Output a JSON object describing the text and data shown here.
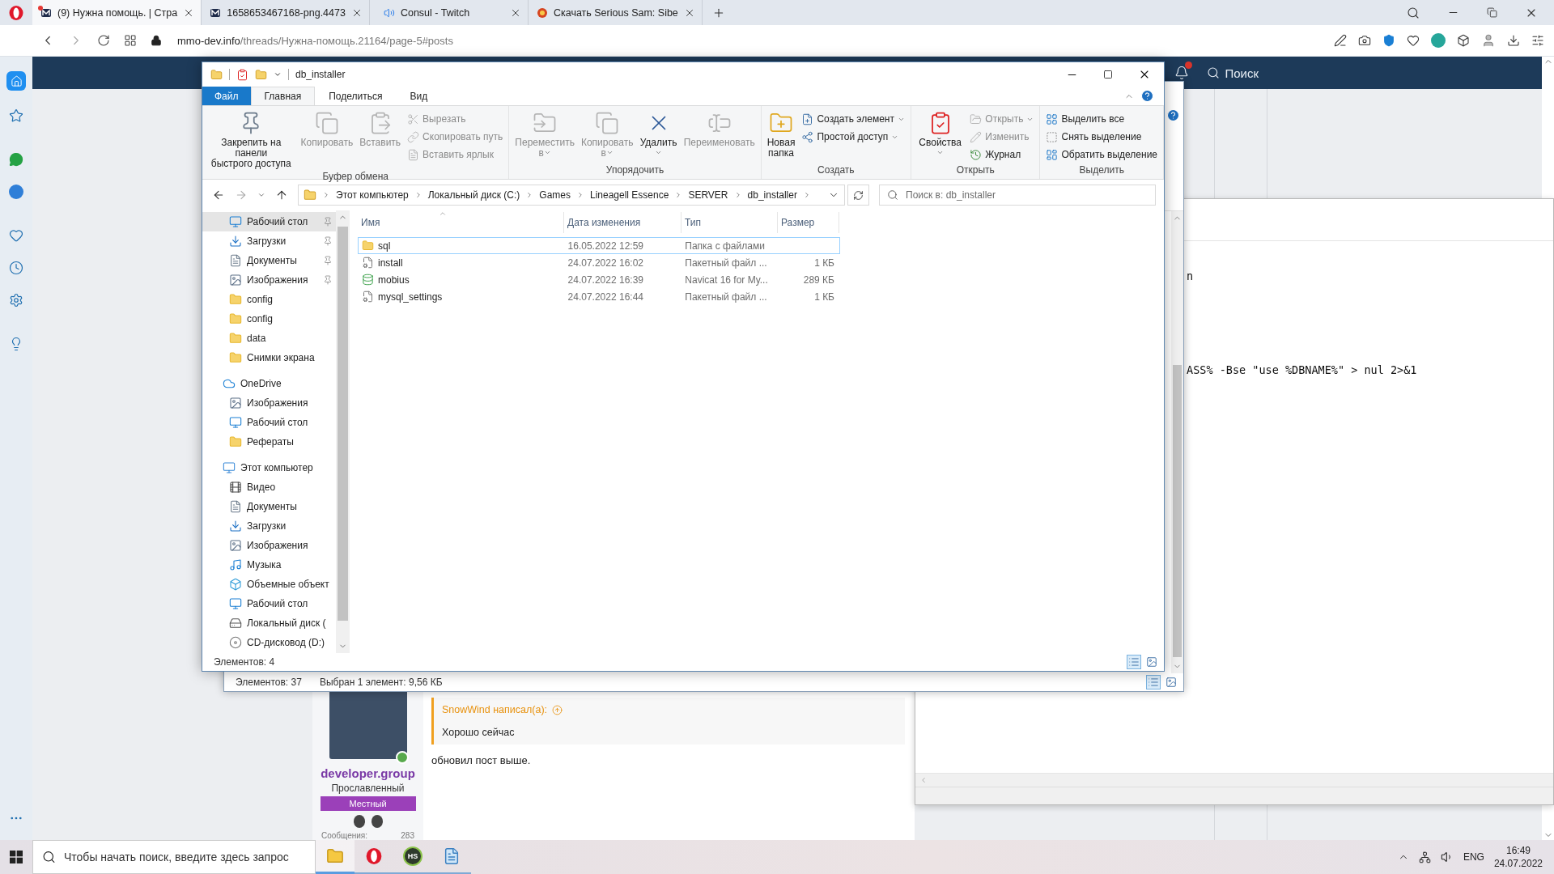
{
  "browser": {
    "tabs": [
      {
        "title": "(9) Нужна помощь. | Стра",
        "kind": "site",
        "unread": true,
        "audio": false,
        "selected": true
      },
      {
        "title": "1658653467168-png.4473",
        "kind": "site",
        "unread": false,
        "audio": false,
        "selected": false
      },
      {
        "title": "Consul - Twitch",
        "kind": "stream",
        "unread": false,
        "audio": true,
        "selected": false
      },
      {
        "title": "Скачать Serious Sam: Sibe",
        "kind": "game",
        "unread": false,
        "audio": false,
        "selected": false
      }
    ],
    "url": {
      "domain": "mmo-dev.info",
      "path": "/threads/Нужна-помощь.21164/page-5#posts"
    }
  },
  "web": {
    "search": "Поиск",
    "post": {
      "author": "developer.group",
      "user_title": "Прославленный",
      "banner": "Местный",
      "stats": [
        {
          "label": "Сообщения:",
          "value": "283"
        }
      ],
      "quote": {
        "author": "SnowWind написал(а):",
        "text": "Хорошо сейчас"
      },
      "message": "обновил пост выше."
    }
  },
  "editor": {
    "lines": [
      "n",
      "ASS% -Bse \"use %DBNAME%\" > nul 2>&1"
    ]
  },
  "old_explorer": {
    "status": [
      "Элементов: 37",
      "Выбран 1 элемент: 9,56 КБ"
    ]
  },
  "explorer": {
    "title": "db_installer",
    "ribbon_tabs": [
      {
        "label": "Файл",
        "kind": "file",
        "selected": false
      },
      {
        "label": "Главная",
        "kind": "tab",
        "selected": true
      },
      {
        "label": "Поделиться",
        "kind": "tab",
        "selected": false
      },
      {
        "label": "Вид",
        "kind": "tab",
        "selected": false
      }
    ],
    "ribbon_groups": [
      {
        "label": "Буфер обмена",
        "items": [
          {
            "kind": "large",
            "label": "Закрепить на панели\nбыстрого доступа",
            "disabled": false,
            "dropdown": false
          },
          {
            "kind": "large",
            "label": "Копировать",
            "disabled": true,
            "dropdown": false
          },
          {
            "kind": "large",
            "label": "Вставить",
            "disabled": true,
            "dropdown": false
          },
          {
            "kind": "stack",
            "items": [
              {
                "label": "Вырезать",
                "disabled": true,
                "dropdown": false
              },
              {
                "label": "Скопировать путь",
                "disabled": true,
                "dropdown": false
              },
              {
                "label": "Вставить ярлык",
                "disabled": true,
                "dropdown": false
              }
            ]
          }
        ]
      },
      {
        "label": "Упорядочить",
        "items": [
          {
            "kind": "large",
            "label": "Переместить\nв",
            "disabled": true,
            "dropdown": true
          },
          {
            "kind": "large",
            "label": "Копировать\nв",
            "disabled": true,
            "dropdown": true
          },
          {
            "kind": "large",
            "label": "Удалить",
            "disabled": false,
            "dropdown": true
          },
          {
            "kind": "large",
            "label": "Переименовать",
            "disabled": true,
            "dropdown": false
          }
        ]
      },
      {
        "label": "Создать",
        "items": [
          {
            "kind": "large",
            "label": "Новая\nпапка",
            "disabled": false,
            "dropdown": false
          },
          {
            "kind": "stack",
            "items": [
              {
                "label": "Создать элемент",
                "disabled": false,
                "dropdown": true
              },
              {
                "label": "Простой доступ",
                "disabled": false,
                "dropdown": true
              }
            ]
          }
        ]
      },
      {
        "label": "Открыть",
        "items": [
          {
            "kind": "large",
            "label": "Свойства",
            "disabled": false,
            "dropdown": true
          },
          {
            "kind": "stack",
            "items": [
              {
                "label": "Открыть",
                "disabled": true,
                "dropdown": true
              },
              {
                "label": "Изменить",
                "disabled": true,
                "dropdown": false
              },
              {
                "label": "Журнал",
                "disabled": false,
                "dropdown": false
              }
            ]
          }
        ]
      },
      {
        "label": "Выделить",
        "items": [
          {
            "kind": "stack",
            "items": [
              {
                "label": "Выделить все",
                "disabled": false,
                "dropdown": false
              },
              {
                "label": "Снять выделение",
                "disabled": false,
                "dropdown": false
              },
              {
                "label": "Обратить выделение",
                "disabled": false,
                "dropdown": false
              }
            ]
          }
        ]
      }
    ],
    "breadcrumbs": [
      "Этот компьютер",
      "Локальный диск (C:)",
      "Games",
      "Lineagell Essence",
      "SERVER",
      "db_installer"
    ],
    "search_placeholder": "Поиск в: db_installer",
    "nav_pane": {
      "quick_access": [
        {
          "label": "Рабочий стол",
          "kind": "desktop",
          "pinned": true,
          "selected": true
        },
        {
          "label": "Загрузки",
          "kind": "download",
          "pinned": true,
          "selected": false
        },
        {
          "label": "Документы",
          "kind": "documents",
          "pinned": true,
          "selected": false
        },
        {
          "label": "Изображения",
          "kind": "pictures",
          "pinned": true,
          "selected": false
        },
        {
          "label": "config",
          "kind": "folder",
          "pinned": false,
          "selected": false
        },
        {
          "label": "config",
          "kind": "folder",
          "pinned": false,
          "selected": false
        },
        {
          "label": "data",
          "kind": "folder",
          "pinned": false,
          "selected": false
        },
        {
          "label": "Снимки экрана",
          "kind": "folder",
          "pinned": false,
          "selected": false
        }
      ],
      "roots": [
        {
          "label": "OneDrive",
          "kind": "onedrive",
          "selected": false,
          "children": [
            {
              "label": "Изображения",
              "kind": "pictures",
              "selected": false
            },
            {
              "label": "Рабочий стол",
              "kind": "desktop",
              "selected": false
            },
            {
              "label": "Рефераты",
              "kind": "folder",
              "selected": false
            }
          ]
        },
        {
          "label": "Этот компьютер",
          "kind": "computer",
          "selected": false,
          "children": [
            {
              "label": "Видео",
              "kind": "video",
              "selected": false
            },
            {
              "label": "Документы",
              "kind": "documents",
              "selected": false
            },
            {
              "label": "Загрузки",
              "kind": "download",
              "selected": false
            },
            {
              "label": "Изображения",
              "kind": "pictures",
              "selected": false
            },
            {
              "label": "Музыка",
              "kind": "music",
              "selected": false
            },
            {
              "label": "Объемные объект",
              "kind": "objects",
              "selected": false
            },
            {
              "label": "Рабочий стол",
              "kind": "desktop",
              "selected": false
            },
            {
              "label": "Локальный диск (",
              "kind": "drive",
              "selected": false
            },
            {
              "label": "CD-дисковод (D:)",
              "kind": "cd",
              "selected": false
            }
          ]
        }
      ]
    },
    "columns": [
      "Имя",
      "Дата изменения",
      "Тип",
      "Размер"
    ],
    "files": [
      {
        "name": "sql",
        "date": "16.05.2022 12:59",
        "type": "Папка с файлами",
        "kind": "folder",
        "focused": true
      },
      {
        "name": "install",
        "date": "24.07.2022 16:02",
        "type": "Пакетный файл ...",
        "size": "1 КБ",
        "kind": "batch",
        "focused": false
      },
      {
        "name": "mobius",
        "date": "24.07.2022 16:39",
        "type": "Navicat 16 for My...",
        "size": "289 КБ",
        "kind": "database",
        "focused": false
      },
      {
        "name": "mysql_settings",
        "date": "24.07.2022 16:44",
        "type": "Пакетный файл ...",
        "size": "1 КБ",
        "kind": "batch",
        "focused": false
      }
    ],
    "status": "Элементов: 4"
  },
  "taskbar": {
    "search_placeholder": "Чтобы начать поиск, введите здесь запрос",
    "apps": [
      {
        "kind": "explorer",
        "active": true
      },
      {
        "kind": "opera",
        "active": false
      },
      {
        "kind": "badge",
        "label": "HS",
        "active": false
      },
      {
        "kind": "notepad",
        "active": false
      }
    ],
    "language": "ENG",
    "time": "16:49",
    "date": "24.07.2022"
  }
}
